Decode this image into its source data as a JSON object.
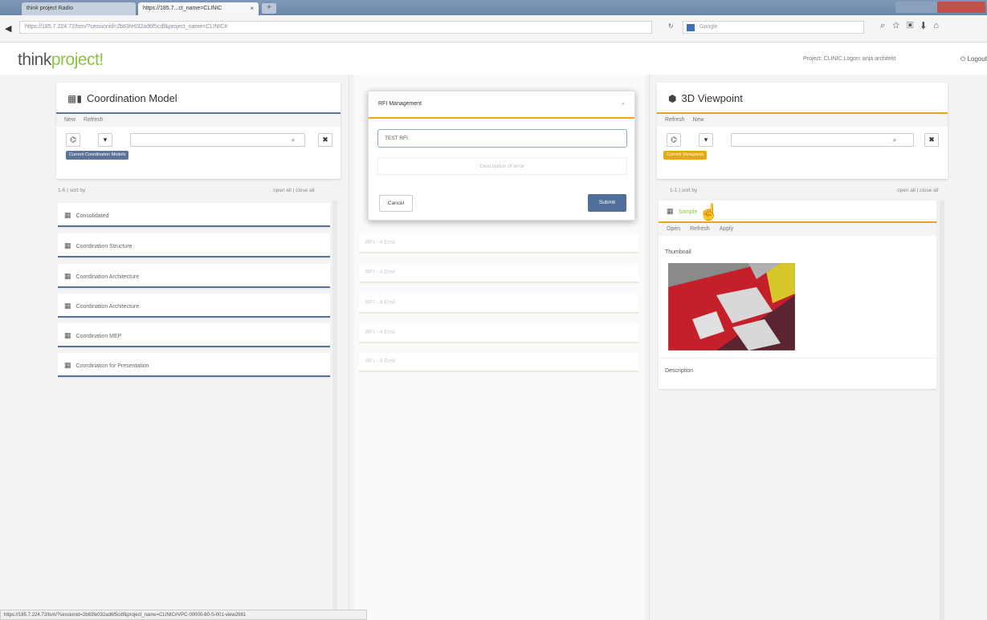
{
  "browser": {
    "tab1_title": "think project Radio",
    "tab2_title": "https://185.7...ct_name=CLINIC",
    "tab_close": "×",
    "new_tab": "+",
    "url": "https://185.7.224.72/tsm/?sessionid=2b83fe032ad6f5cdf&project_name=CLINIC#",
    "search_placeholder": "Google",
    "status_url": "https://185.7.224.72/tsm/?sessionid=2b83fe032ad6f5cdf&project_name=CLINIC#VPC-00000-80-S-001-view2981"
  },
  "header": {
    "logo_a": "think",
    "logo_b": "project!",
    "project_info": "Project: CLINIC  Logon: anja architekt",
    "logout": "Logout"
  },
  "left": {
    "title": "Coordination Model",
    "menu": [
      "New",
      "Refresh"
    ],
    "chip": "Current Coordination Models",
    "list_info": "1-6 | sort by",
    "open_close": "open all | close all",
    "items": [
      "Consolidated",
      "Coordination Structure",
      "Coordination Architecture",
      "Coordination Architecture",
      "Coordination MEP",
      "Coordination for Presentation"
    ]
  },
  "middle": {
    "ghost_items": [
      "RFI - 4 Emil",
      "RFI - 4 Emil",
      "RFI - 4 Emil",
      "RFI - 4 Emil",
      "RFI - 4 Emil"
    ]
  },
  "modal": {
    "title": "RFI Management",
    "close": "×",
    "input_value": "TEST RFI",
    "hint": "Description of error",
    "cancel": "Cancel",
    "submit": "Submit"
  },
  "right": {
    "title": "3D Viewpoint",
    "menu": [
      "Refresh",
      "New"
    ],
    "chip": "Current Viewpoints",
    "list_info": "1-1 | sort by",
    "open_close": "open all | close all",
    "item_label": "Sample",
    "detail_menu": [
      "Open",
      "Refresh",
      "Apply"
    ],
    "thumbnail_label": "Thumbnail",
    "description_label": "Description"
  },
  "colors": {
    "accent_blue": "#5b7399",
    "accent_yellow": "#e6a817",
    "logo_green": "#8bc43f"
  }
}
